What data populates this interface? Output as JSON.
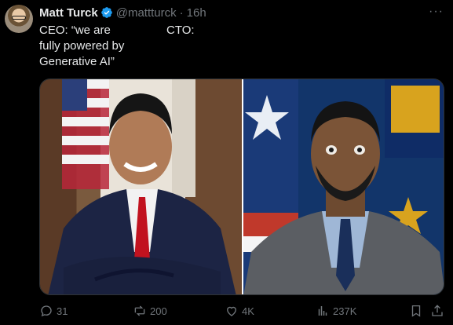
{
  "author": {
    "display_name": "Matt Turck",
    "handle": "@mattturck",
    "separator": "·",
    "timestamp": "16h",
    "verified": true
  },
  "tweet": {
    "ceo_text": "CEO: “we are\nfully powered by\nGenerative AI”",
    "cto_text": "CTO:"
  },
  "media": {
    "left_icon": "ceo-photo",
    "right_icon": "cto-photo"
  },
  "actions": {
    "replies": "31",
    "reposts": "200",
    "likes": "4K",
    "views": "237K"
  },
  "colors": {
    "background": "#000000",
    "text": "#e7e9ea",
    "muted": "#71767b",
    "verified": "#1d9bf0"
  }
}
